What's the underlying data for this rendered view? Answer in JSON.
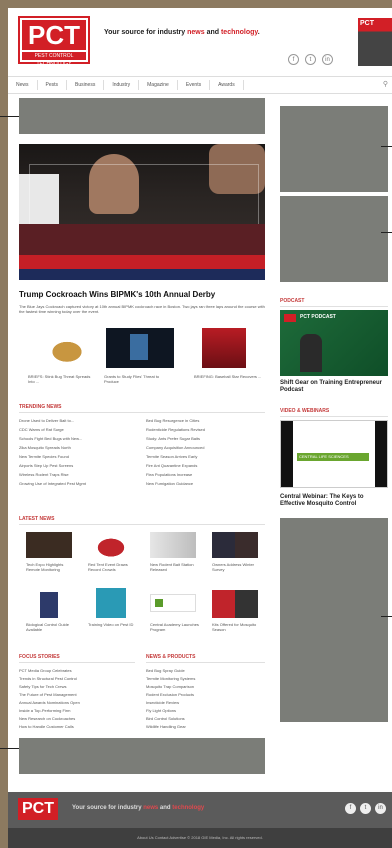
{
  "logo": {
    "main": "PCT",
    "small": "PEST CONTROL TECHNOLOGY"
  },
  "tagline": {
    "prefix": "Your source for industry ",
    "news": "news",
    "mid": " and ",
    "tech": "technology",
    "suffix": "."
  },
  "nav": [
    "News",
    "Pests",
    "Business",
    "Industry",
    "Magazine",
    "Events",
    "Awards"
  ],
  "hero": {
    "title": "Trump Cockroach Wins BIPMK's 10th Annual Derby",
    "subtitle": "The Blue Jays Cockroach captured victory at 10th annual BIPMK cockroach race in Boston. Two jays ran three laps around the course with the fastest time winning today over the event."
  },
  "thumbs": [
    {
      "caption": "BRIEFS: Stink Bug Threat Spreads Into ..."
    },
    {
      "caption": "Grants to Study Flies' Threat to Produce"
    },
    {
      "caption": "BRIEFING: Baseball Star Recovers ..."
    }
  ],
  "sections": {
    "trending": "TRENDING NEWS",
    "latest": "LATEST NEWS",
    "focus": "FOCUS STORIES",
    "products": "NEWS & PRODUCTS"
  },
  "trending_left": [
    "Drone Used to Deliver Bait to...",
    "CDC Warns of Rat Surge",
    "Schools Fight Bed Bugs with New...",
    "Zika Mosquito Spreads North",
    "New Termite Species Found",
    "Airports Step Up Pest Screens",
    "Wireless Rodent Traps Rise",
    "Growing Use of Integrated Pest Mgmt"
  ],
  "trending_right": [
    "Bed Bug Resurgence in Cities",
    "Rodenticide Regulations Revised",
    "Study: Ants Prefer Sugar Baits",
    "Company Acquisition Announced",
    "Termite Season Arrives Early",
    "Fire Ant Quarantine Expands",
    "Flea Populations Increase",
    "New Fumigation Guidance"
  ],
  "latest": [
    {
      "caption": "Tech Expo Highlights Remote Monitoring"
    },
    {
      "caption": "Red Tent Event Draws Record Crowds"
    },
    {
      "caption": "New Rodent Bait Station Released"
    },
    {
      "caption": "Owners Address Winter Survey"
    },
    {
      "caption": "Biological Control Guide Available"
    },
    {
      "caption": "Training Video on Pest ID"
    },
    {
      "caption": "Central Academy Launches Program"
    },
    {
      "caption": "Kits Offered for Mosquito Season"
    }
  ],
  "focus_left": [
    "PCT Media Group Celebrates",
    "Trends in Structural Pest Control",
    "Safety Tips for Tech Crews",
    "The Future of Pest Management",
    "Annual Awards Nominations Open",
    "Inside a Top-Performing Firm",
    "New Research on Cockroaches",
    "How to Handle Customer Calls"
  ],
  "focus_right": [
    "Bed Bug Spray Guide",
    "Termite Monitoring Systems",
    "Mosquito Trap Comparison",
    "Rodent Exclusion Products",
    "Insecticide Review",
    "Fly Light Options",
    "Bird Control Solutions",
    "Wildlife Handling Gear"
  ],
  "sidebar": {
    "podcast_header": "PODCAST",
    "podcast_badge": "PCT PODCAST",
    "podcast_title": "Shift Gear on Training Entrepreneur Podcast",
    "webinar_header": "VIDEO & WEBINARS",
    "webinar_title": "Central Webinar: The Keys to Effective Mosquito Control",
    "webinar_brand": "CENTRAL LIFE SCIENCES"
  },
  "footer": {
    "logo": "PCT",
    "tag_prefix": "Your source for industry ",
    "tag_news": "news",
    "tag_mid": " and ",
    "tag_tech": "technology",
    "copyright": "About Us    Contact    Advertise    © 2018 GIE Media, Inc. All rights reserved."
  },
  "colors": {
    "brand_red": "#d21f26",
    "ad_gray": "#7b7d78",
    "frame": "#8c7a60"
  }
}
